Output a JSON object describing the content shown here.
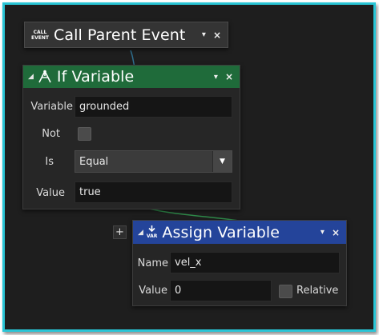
{
  "colors": {
    "frame_border": "#29c5d6",
    "if_variable_header": "#1f6b3a",
    "assign_variable_header": "#24449a",
    "call_parent_header": "#343434"
  },
  "nodes": {
    "call_parent_event": {
      "icon_name": "call-event-icon",
      "icon_text_line1": "CALL",
      "icon_text_line2": "EVENT",
      "title": "Call Parent Event"
    },
    "if_variable": {
      "icon_name": "branch-icon",
      "title": "If Variable",
      "variable_label": "Variable",
      "variable_value": "grounded",
      "not_label": "Not",
      "not_checked": false,
      "is_label": "Is",
      "is_value": "Equal",
      "value_label": "Value",
      "value_value": "true"
    },
    "assign_variable": {
      "icon_name": "var-download-icon",
      "icon_text": "VAR",
      "title": "Assign Variable",
      "name_label": "Name",
      "name_value": "vel_x",
      "value_label": "Value",
      "value_value": "0",
      "relative_label": "Relative",
      "relative_checked": false
    }
  },
  "controls": {
    "collapse_glyph": "◢",
    "menu_glyph": "▾",
    "close_glyph": "×",
    "add_glyph": "+",
    "dropdown_glyph": "▼"
  }
}
